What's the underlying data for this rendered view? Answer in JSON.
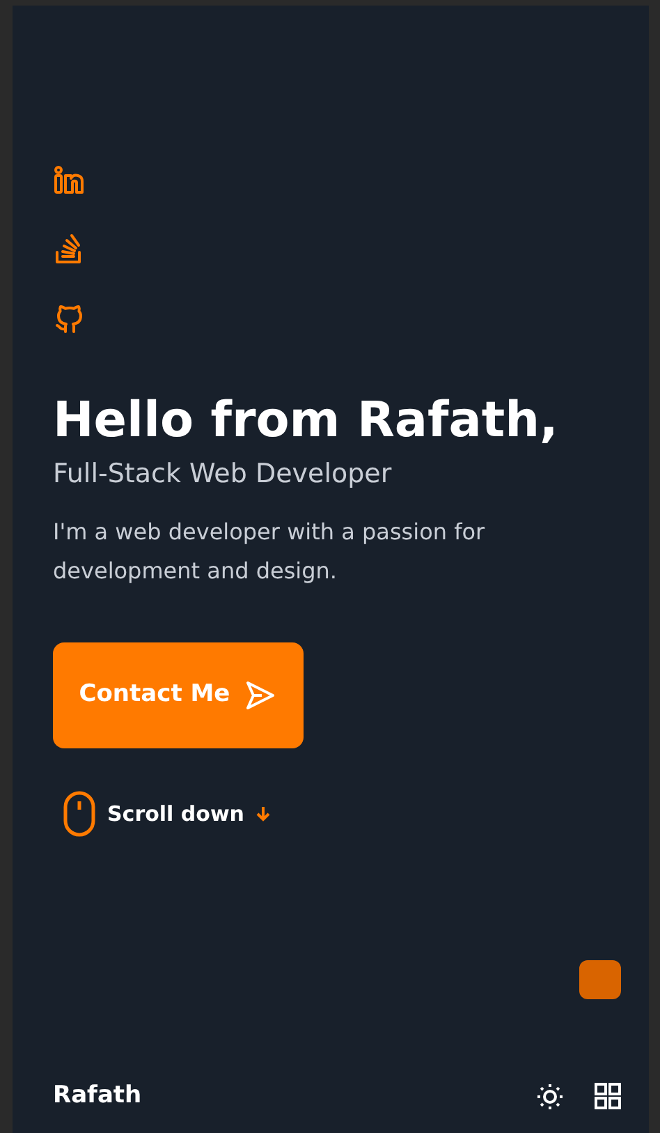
{
  "social_links": [
    {
      "kind": "linkedin"
    },
    {
      "kind": "stackoverflow"
    },
    {
      "kind": "github"
    }
  ],
  "hero": {
    "title": "Hello from Rafath,",
    "subtitle": "Full-Stack Web Developer",
    "description": "I'm a web developer with a passion for development and design.",
    "button": "Contact Me",
    "scroll": "Scroll down"
  },
  "footer": {
    "brand": "Rafath"
  }
}
